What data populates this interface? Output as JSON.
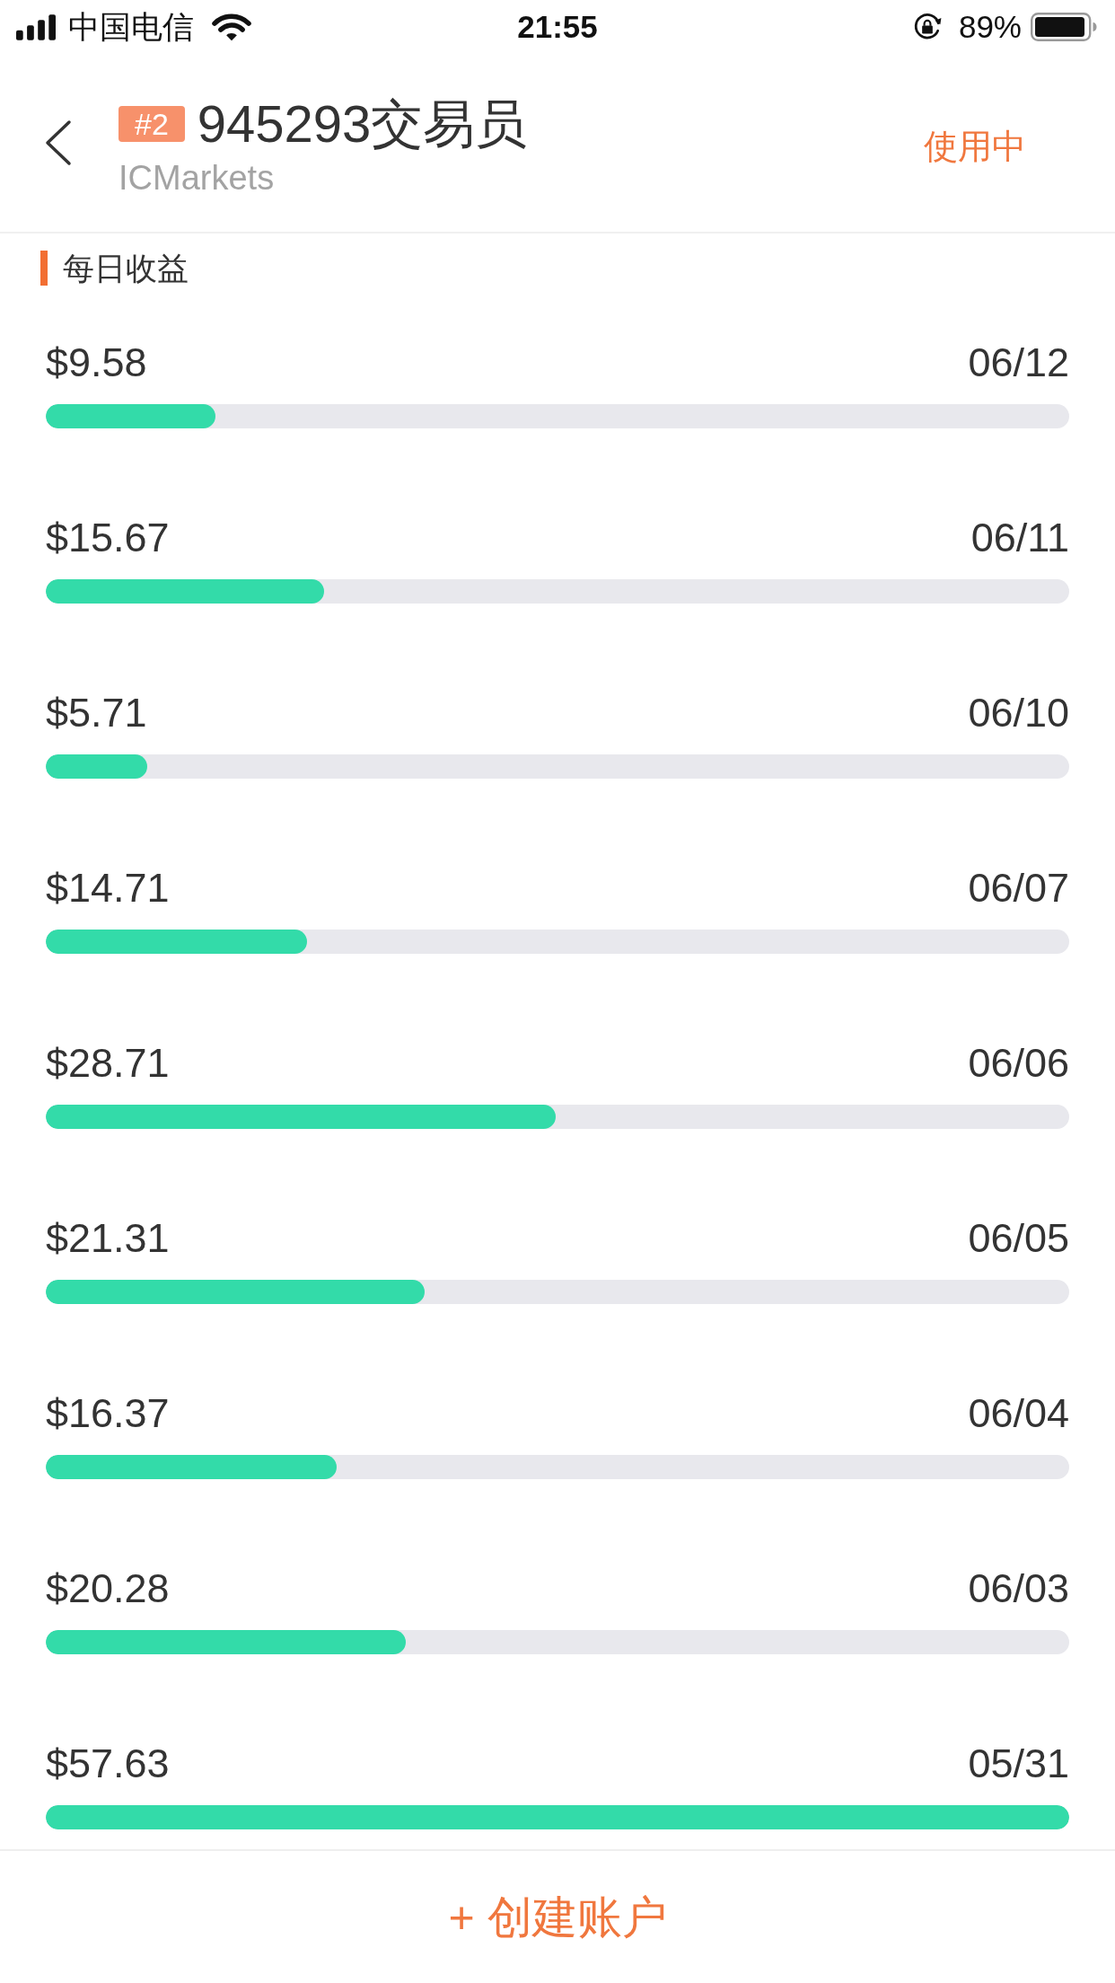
{
  "status_bar": {
    "carrier": "中国电信",
    "time": "21:55",
    "battery": "89%"
  },
  "header": {
    "badge": "#2",
    "title": "945293交易员",
    "subtitle": "ICMarkets",
    "status": "使用中"
  },
  "section": {
    "title": "每日收益"
  },
  "earnings": [
    {
      "amount": "$9.58",
      "date": "06/12",
      "level": 0.166
    },
    {
      "amount": "$15.67",
      "date": "06/11",
      "level": 0.272
    },
    {
      "amount": "$5.71",
      "date": "06/10",
      "level": 0.099
    },
    {
      "amount": "$14.71",
      "date": "06/07",
      "level": 0.255
    },
    {
      "amount": "$28.71",
      "date": "06/06",
      "level": 0.498
    },
    {
      "amount": "$21.31",
      "date": "06/05",
      "level": 0.37
    },
    {
      "amount": "$16.37",
      "date": "06/04",
      "level": 0.284
    },
    {
      "amount": "$20.28",
      "date": "06/03",
      "level": 0.352
    },
    {
      "amount": "$57.63",
      "date": "05/31",
      "level": 1
    }
  ],
  "footer": {
    "button": "+ 创建账户"
  }
}
